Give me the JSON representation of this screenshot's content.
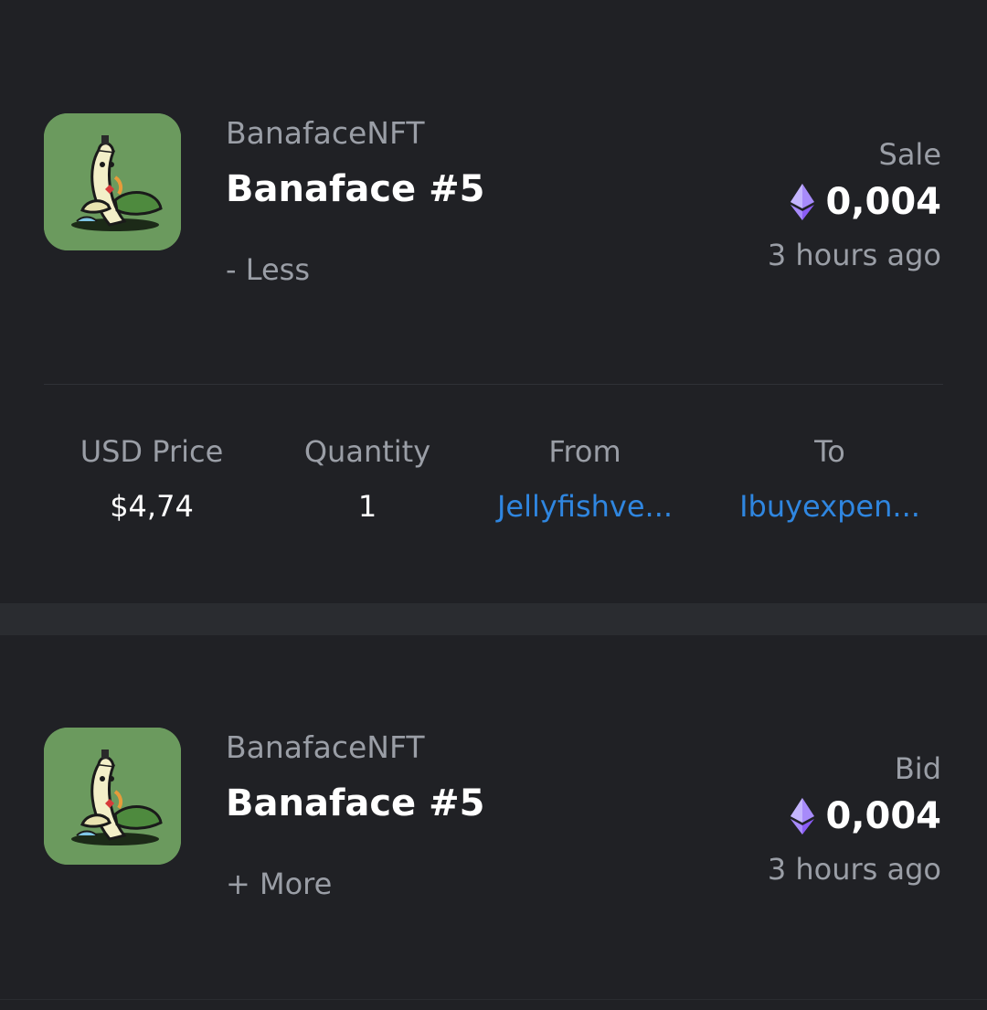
{
  "colors": {
    "background": "#202125",
    "separator_band": "#2a2c30",
    "muted_text": "#9a9ea6",
    "link": "#2f86e0",
    "thumbnail_bg": "#6b9a5e",
    "eth_icon": "#a78bfa"
  },
  "icons": {
    "currency": "ethereum-icon",
    "thumbnail": "banana-nft-image"
  },
  "activity": [
    {
      "collection": "BanafaceNFT",
      "name": "Banaface #5",
      "toggle_label": "- Less",
      "event_type": "Sale",
      "price": "0,004",
      "time_ago": "3 hours ago",
      "details": {
        "usd_price_label": "USD Price",
        "usd_price": "$4,74",
        "quantity_label": "Quantity",
        "quantity": "1",
        "from_label": "From",
        "from": "Jellyfishve...",
        "to_label": "To",
        "to": "Ibuyexpen..."
      }
    },
    {
      "collection": "BanafaceNFT",
      "name": "Banaface #5",
      "toggle_label": "+ More",
      "event_type": "Bid",
      "price": "0,004",
      "time_ago": "3 hours ago"
    }
  ]
}
